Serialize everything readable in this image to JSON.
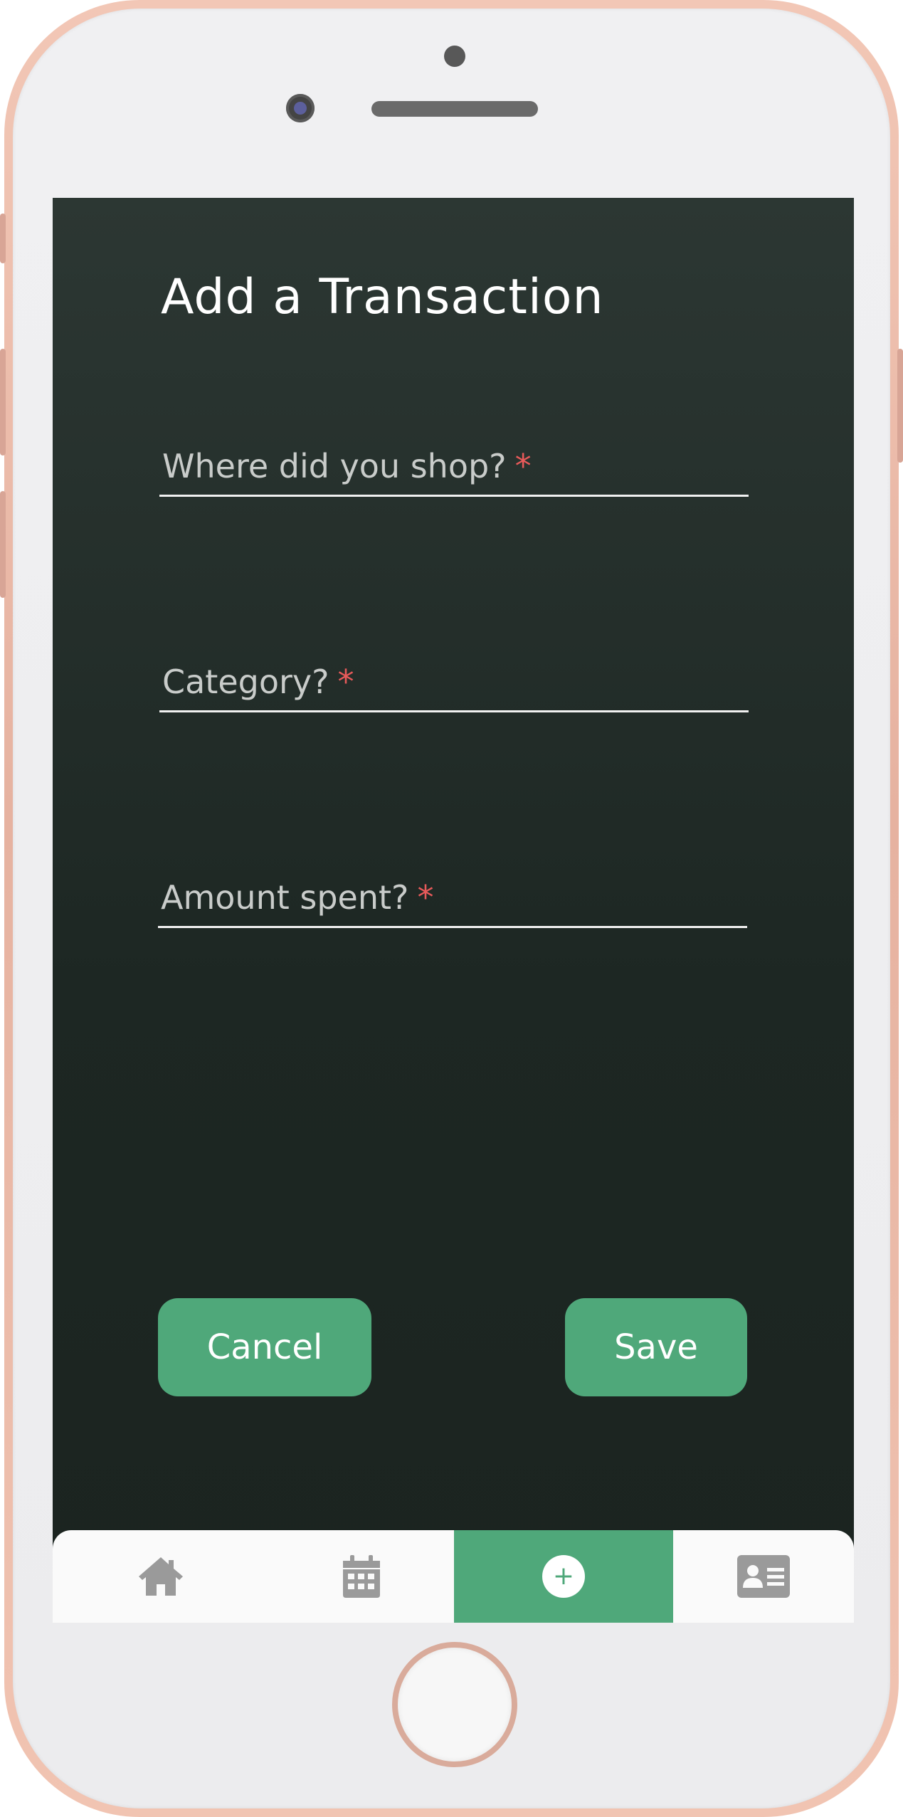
{
  "screen": {
    "title": "Add a Transaction"
  },
  "form": {
    "fields": [
      {
        "label": "Where did you shop?",
        "required_mark": "*",
        "value": ""
      },
      {
        "label": "Category?",
        "required_mark": "*",
        "value": ""
      },
      {
        "label": "Amount spent?",
        "required_mark": "*",
        "value": ""
      }
    ],
    "cancel_label": "Cancel",
    "save_label": "Save"
  },
  "tabbar": {
    "items": [
      {
        "icon": "home-icon",
        "active": false
      },
      {
        "icon": "calendar-icon",
        "active": false
      },
      {
        "icon": "plus-icon",
        "glyph": "+",
        "active": true
      },
      {
        "icon": "contact-card-icon",
        "active": false
      }
    ]
  },
  "colors": {
    "accent": "#4fa87a",
    "required": "#e85a5a",
    "background": "#1e2824",
    "tab_icon": "#9a9a9a"
  }
}
